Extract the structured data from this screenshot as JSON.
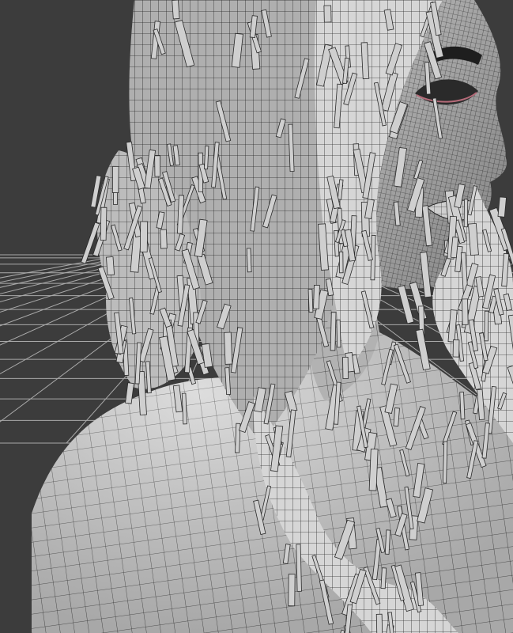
{
  "viewport": {
    "background_color": "#3c3c3c",
    "grid_color": "#a9a9a9",
    "mesh_fill_color": "#cfcfcf",
    "wire_color": "#2a2a2a",
    "accent_color": "#b46a78",
    "shading": "wireframe-on-shaded"
  }
}
